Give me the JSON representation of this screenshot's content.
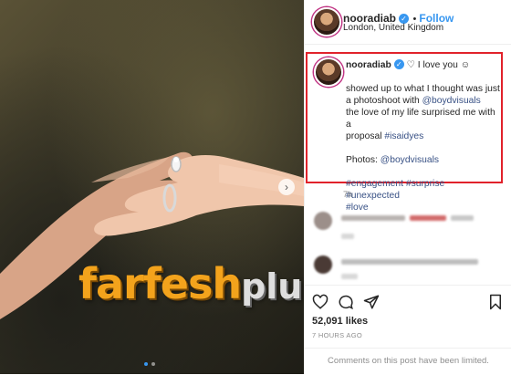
{
  "post": {
    "username": "nooradiab",
    "follow_label": "Follow",
    "location": "London, United Kingdom",
    "verified_mark": "✓",
    "caption_suffix": "♡ I love you ☺",
    "caption_line1": "showed up to what I thought was just",
    "caption_line2_prefix": "a photoshoot with ",
    "mention": "@boydvisuals",
    "caption_line3": "the love of my life surprised me with a",
    "caption_line4_prefix": "proposal ",
    "hashtag_isaidyes": "#isaidyes",
    "photos_prefix": "Photos: ",
    "photos_mention": "@boydvisuals",
    "hashtags_line1": "#engagement #surprise #unexpected",
    "hashtags_line2": "#love",
    "caption_time": "7h",
    "likes": "52,091 likes",
    "time_ago": "7 HOURS AGO",
    "comments_limited": "Comments on this post have been limited."
  },
  "watermark": {
    "main": "farfesh",
    "plus": "plus.com"
  },
  "icons": {
    "heart": "heart-icon",
    "comment": "comment-icon",
    "share": "share-icon",
    "bookmark": "bookmark-icon",
    "next": "chevron-right-icon"
  }
}
